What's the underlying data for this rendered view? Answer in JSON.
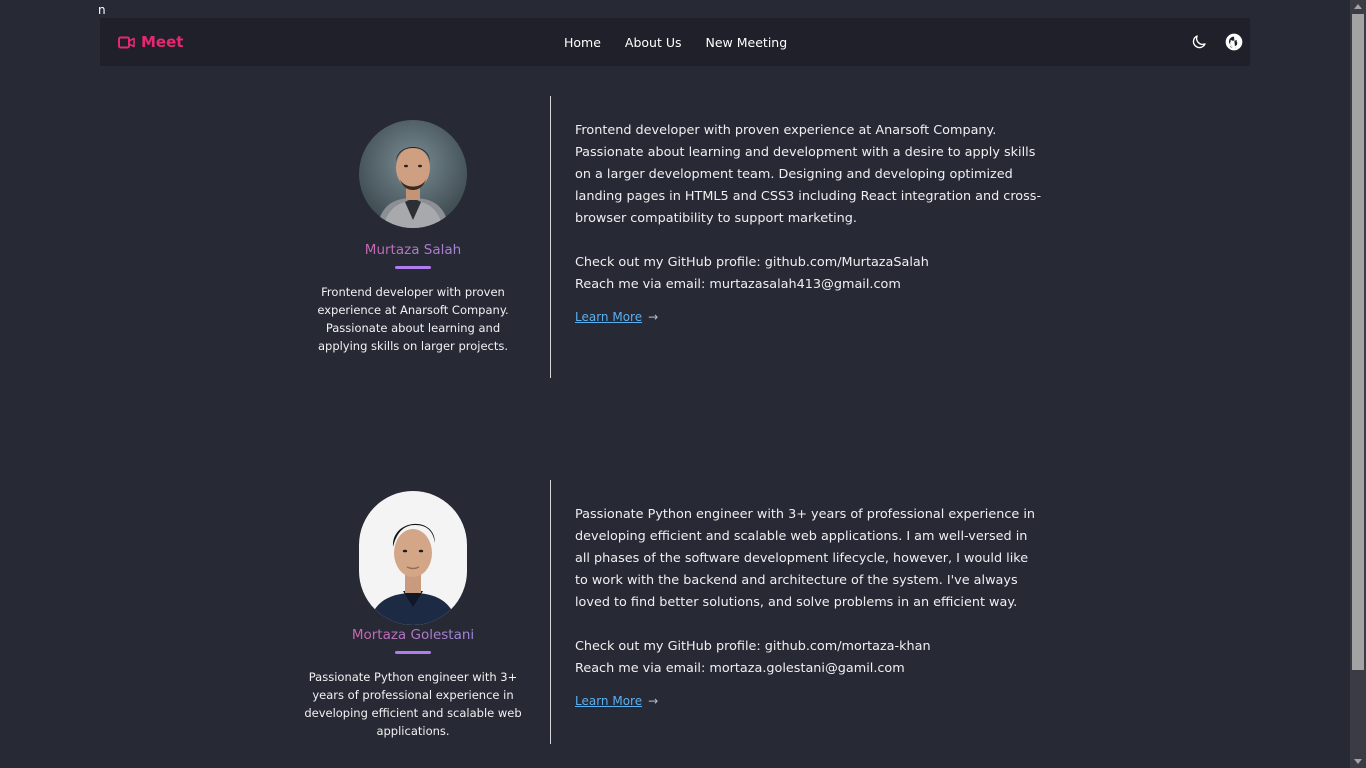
{
  "stray_text": "n",
  "navbar": {
    "brand": "Meet",
    "links": [
      "Home",
      "About Us",
      "New Meeting"
    ],
    "icons": [
      "moon-icon",
      "github-icon"
    ]
  },
  "profiles": [
    {
      "name": "Murtaza Salah",
      "short_bio": "Frontend developer with proven experience at Anarsoft Company. Passionate about learning and applying skills on larger projects.",
      "bio": "Frontend developer with proven experience at Anarsoft Company. Passionate about learning and development with a desire to apply skills on a larger development team. Designing and developing optimized landing pages in HTML5 and CSS3 including React integration and cross-browser compatibility to support marketing.",
      "github_line": "Check out my GitHub profile: github.com/MurtazaSalah",
      "email_line": "Reach me via email: murtazasalah413@gmail.com",
      "learn_more": "Learn More"
    },
    {
      "name": "Mortaza Golestani",
      "short_bio": "Passionate Python engineer with 3+ years of professional experience in developing efficient and scalable web applications.",
      "bio": "Passionate Python engineer with 3+ years of professional experience in developing efficient and scalable web applications. I am well-versed in all phases of the software development lifecycle, however, I would like to work with the backend and architecture of the system. I've always loved to find better solutions, and solve problems in an efficient way.",
      "github_line": "Check out my GitHub profile: github.com/mortaza-khan",
      "email_line": "Reach me via email: mortaza.golestani@gamil.com",
      "learn_more": "Learn More"
    }
  ],
  "colors": {
    "background": "#272935",
    "navbar": "#1f2029",
    "brand": "#e6296f",
    "link": "#5ab0f0",
    "name_underline": "#b07cf0"
  }
}
